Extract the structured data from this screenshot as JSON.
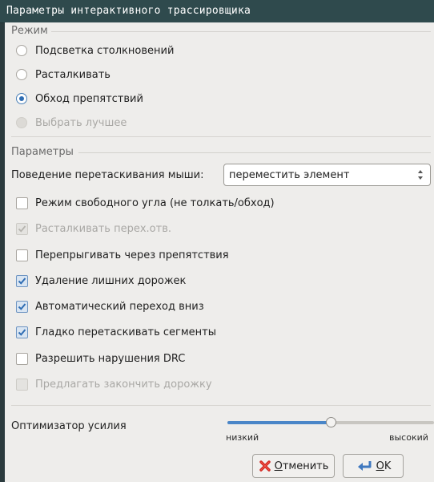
{
  "window": {
    "title": "Параметры интерактивного трассировщика"
  },
  "mode": {
    "group_title": "Режим",
    "options": [
      {
        "label": "Подсветка столкновений",
        "checked": false,
        "disabled": false
      },
      {
        "label": "Расталкивать",
        "checked": false,
        "disabled": false
      },
      {
        "label": "Обход препятствий",
        "checked": true,
        "disabled": false
      },
      {
        "label": "Выбрать лучшее",
        "checked": false,
        "disabled": true
      }
    ]
  },
  "options": {
    "group_title": "Параметры",
    "drag_behavior": {
      "label": "Поведение перетаскивания мыши:",
      "value": "переместить элемент"
    },
    "checkboxes": [
      {
        "label": "Режим свободного угла (не толкать/обход)",
        "checked": false,
        "disabled": false
      },
      {
        "label": "Расталкивать перех.отв.",
        "checked": true,
        "disabled": true
      },
      {
        "label": "Перепрыгивать через препятствия",
        "checked": false,
        "disabled": false
      },
      {
        "label": "Удаление лишних дорожек",
        "checked": true,
        "disabled": false
      },
      {
        "label": "Автоматический переход вниз",
        "checked": true,
        "disabled": false
      },
      {
        "label": "Гладко перетаскивать сегменты",
        "checked": true,
        "disabled": false
      },
      {
        "label": "Разрешить нарушения DRC",
        "checked": false,
        "disabled": false
      },
      {
        "label": "Предлагать закончить дорожку",
        "checked": false,
        "disabled": true
      }
    ]
  },
  "optimizer": {
    "label": "Оптимизатор усилия",
    "min_label": "низкий",
    "max_label": "высокий",
    "value_fraction": 0.5
  },
  "buttons": {
    "cancel_label": "Отменить",
    "cancel_mnemonic": "О",
    "cancel_rest": "тменить",
    "ok_label": "OK",
    "ok_mnemonic": "O",
    "ok_rest": "K"
  },
  "colors": {
    "accent": "#2f6db3",
    "titlebar": "#2f4a4d",
    "dialog_bg": "#eeedeb"
  },
  "icons": {
    "cancel": "red-x-icon",
    "ok": "return-arrow-icon",
    "check": "checkmark-icon",
    "combo": "up-down-arrows-icon"
  }
}
